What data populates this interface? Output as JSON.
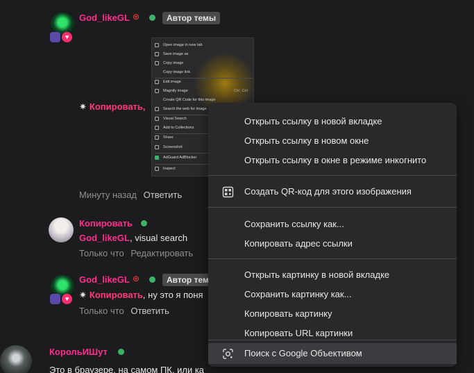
{
  "comments": [
    {
      "username": "God_likeGL",
      "author_tag": "Автор темы",
      "body_mention": "Копировать",
      "time": "Минуту назад",
      "reply": "Ответить"
    },
    {
      "username": "Копировать",
      "body_mention": "God_likeGL",
      "body_text": ", visual search",
      "time": "Только что",
      "edit": "Редактировать"
    },
    {
      "username": "God_likeGL",
      "author_tag": "Автор темы",
      "body_mention": "Копировать",
      "body_text": ", ну это я поня",
      "time": "Только что",
      "reply": "Ответить"
    },
    {
      "username": "КорольИШут",
      "body_text": "Это в браузере, на самом ПК, или ка"
    }
  ],
  "embedded_menu": [
    "Open image in new tab",
    "Save image as",
    "Copy image",
    "Copy image link",
    "Edit image",
    "Magnify image",
    "Create QR Code for this image",
    "Search the web for image",
    "Visual Search",
    "Add to Collections",
    "Share",
    "Screenshot",
    "AdGuard AdBlocker",
    "Inspect"
  ],
  "embedded_shortcut": "Ctrl, Ctrl",
  "context_menu": {
    "group1": [
      "Открыть ссылку в новой вкладке",
      "Открыть ссылку в новом окне",
      "Открыть ссылку в окне в режиме инкогнито"
    ],
    "qr": "Создать QR-код для этого изображения",
    "group2": [
      "Сохранить ссылку как...",
      "Копировать адрес ссылки"
    ],
    "group3": [
      "Открыть картинку в новой вкладке",
      "Сохранить картинку как...",
      "Копировать картинку",
      "Копировать URL картинки"
    ],
    "lens": "Поиск с Google Объективом"
  },
  "colors": {
    "background": "#1c1c1e",
    "username_pink": "#ff2d8e",
    "online_green": "#3db36a",
    "menu_bg": "#28292b"
  }
}
